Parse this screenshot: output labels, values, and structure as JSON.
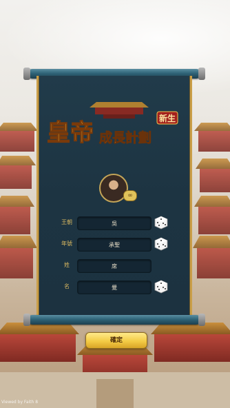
{
  "logo": {
    "title": "皇帝",
    "subtitle": "成長計劃",
    "badge": "新生"
  },
  "form": {
    "rows": [
      {
        "label": "王朝",
        "value": "吳",
        "has_dice": true
      },
      {
        "label": "年號",
        "value": "承聖",
        "has_dice": true
      },
      {
        "label": "姓",
        "value": "席",
        "has_dice": false
      },
      {
        "label": "名",
        "value": "覺",
        "has_dice": true
      }
    ]
  },
  "confirm_label": "確定",
  "watermark": "Viewed by Faith 8"
}
